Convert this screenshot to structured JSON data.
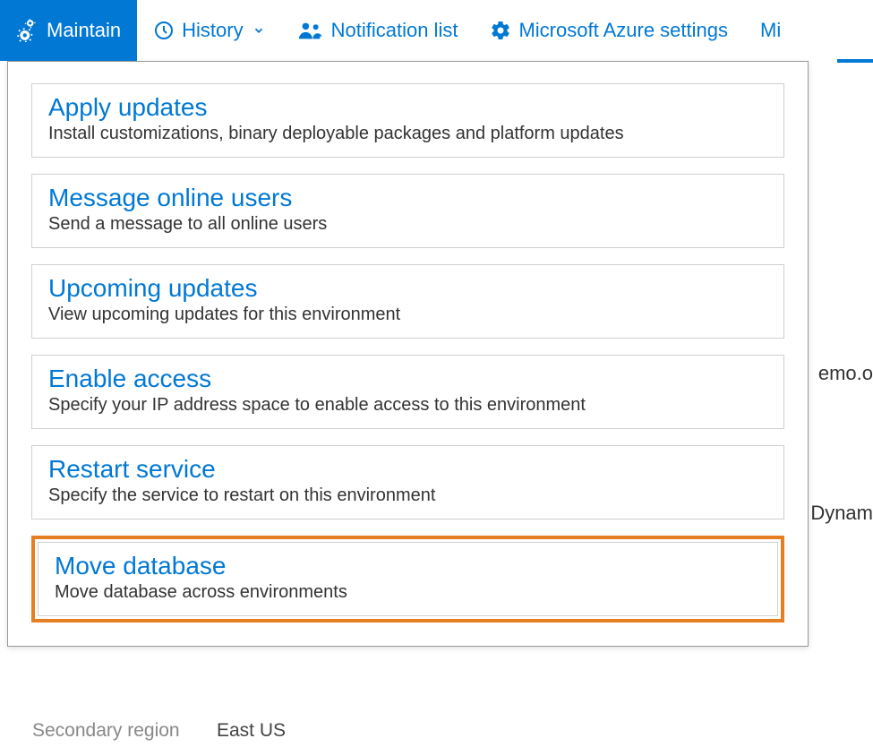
{
  "toolbar": {
    "maintain": "Maintain",
    "history": "History",
    "notification_list": "Notification list",
    "azure_settings": "Microsoft Azure settings",
    "truncated": "Mi"
  },
  "dropdown": {
    "items": [
      {
        "title": "Apply updates",
        "desc": "Install customizations, binary deployable packages and platform updates"
      },
      {
        "title": "Message online users",
        "desc": "Send a message to all online users"
      },
      {
        "title": "Upcoming updates",
        "desc": "View upcoming updates for this environment"
      },
      {
        "title": "Enable access",
        "desc": "Specify your IP address space to enable access to this environment"
      },
      {
        "title": "Restart service",
        "desc": "Specify the service to restart on this environment"
      },
      {
        "title": "Move database",
        "desc": "Move database across environments"
      }
    ]
  },
  "background": {
    "text1": "emo.o",
    "text2": "Dynam",
    "label": "Secondary region",
    "value": "East US"
  }
}
